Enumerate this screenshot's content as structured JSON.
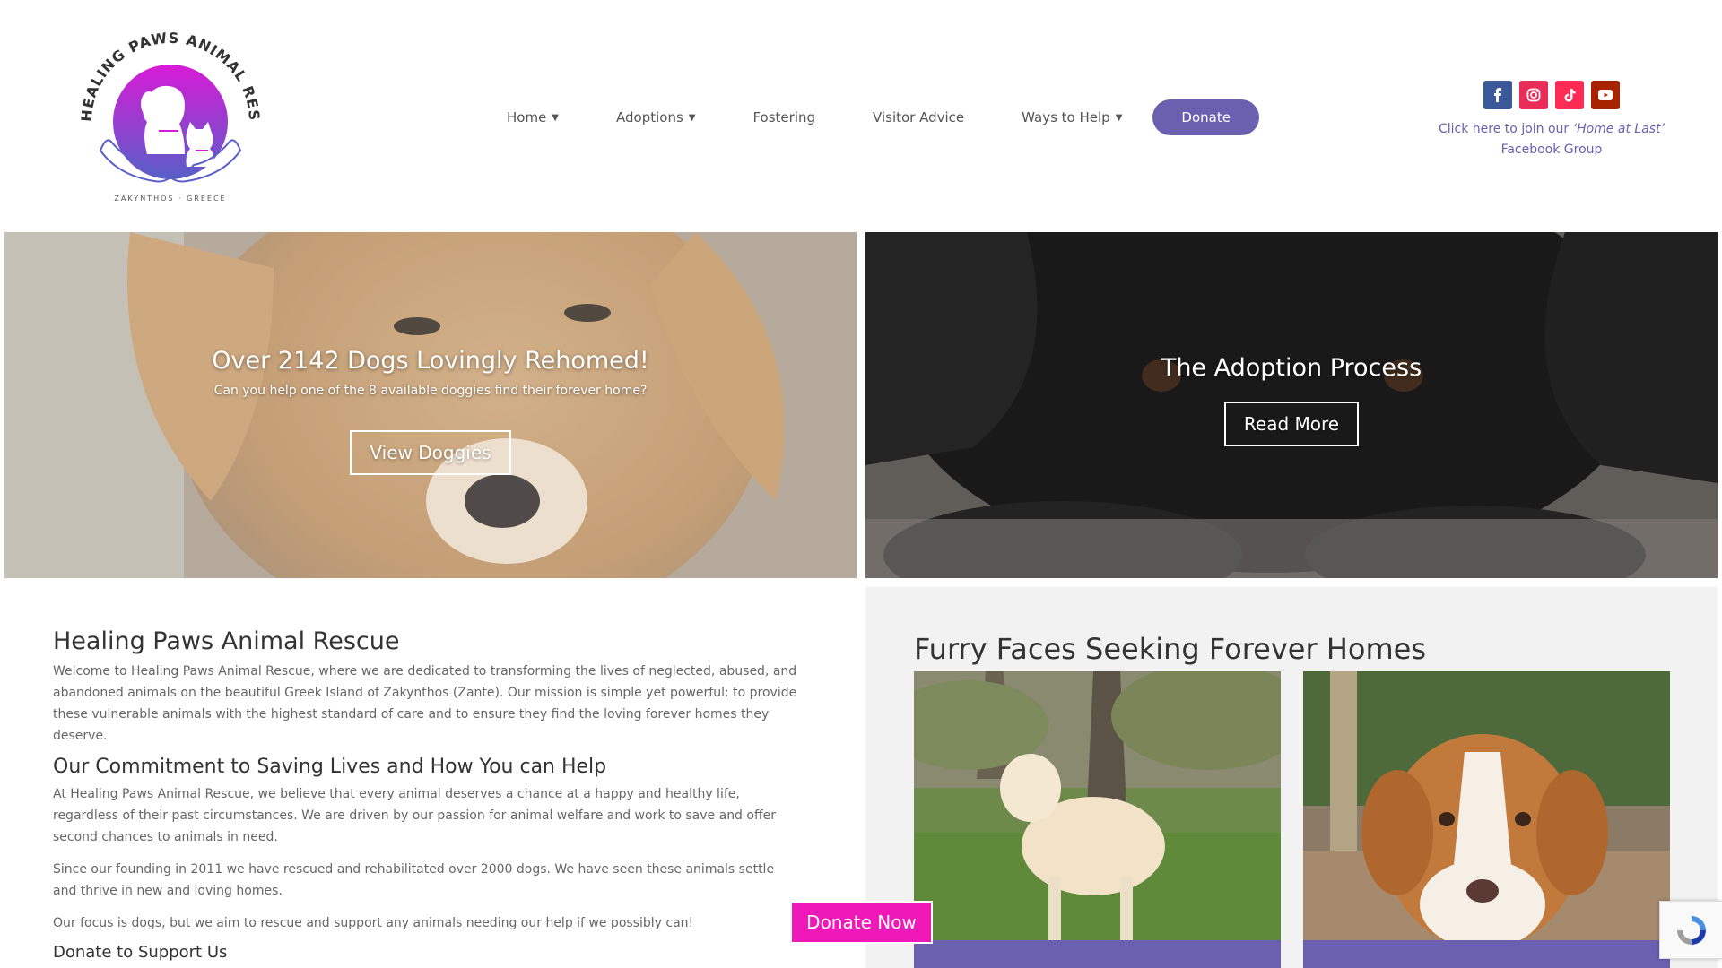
{
  "logo": {
    "arc_text": "HEALING PAWS ANIMAL RESCUE",
    "location": "ZAKYNTHOS · GREECE"
  },
  "nav": {
    "items": [
      {
        "label": "Home",
        "caret": "▼"
      },
      {
        "label": "Adoptions",
        "caret": "▼"
      },
      {
        "label": "Fostering"
      },
      {
        "label": "Visitor Advice"
      },
      {
        "label": "Ways to Help",
        "caret": "▼"
      }
    ],
    "donate_label": "Donate"
  },
  "socials": [
    {
      "icon": "facebook-icon",
      "color": "#3b5998"
    },
    {
      "icon": "instagram-icon",
      "color": "#ea2c59"
    },
    {
      "icon": "tiktok-icon",
      "color": "#fe2c55"
    },
    {
      "icon": "youtube-icon",
      "color": "#a82400"
    }
  ],
  "fb_group": {
    "prefix": "Click here to join our ",
    "name": "‘Home at Last’",
    "suffix": "Facebook Group"
  },
  "hero_left": {
    "title": "Over 2142 Dogs Lovingly Rehomed!",
    "subtitle": "Can you help one of the 8 available doggies find their forever home?",
    "button": "View Doggies"
  },
  "hero_right": {
    "title": "The Adoption Process",
    "button": "Read More"
  },
  "intro": {
    "title": "Healing Paws Animal Rescue",
    "p1": "Welcome to Healing Paws Animal Rescue, where we are dedicated to transforming the lives of neglected, abused, and abandoned animals on the beautiful Greek Island of Zakynthos (Zante). Our mission is simple yet powerful: to provide these vulnerable animals with the highest standard of care and to ensure they find the loving forever homes they deserve.",
    "h_commit": "Our Commitment to Saving Lives and How You can Help",
    "p2": "At Healing Paws Animal Rescue, we believe that every animal deserves a chance at a happy and healthy life, regardless of their past circumstances. We are driven by our passion for animal welfare and work to save and offer second chances to animals in need.",
    "p3": "Since our founding in 2011 we have rescued and rehabilitated over 2000 dogs. We have seen these animals settle and thrive in new and loving homes.",
    "p4": "Our focus is dogs, but we aim to rescue and support any animals needing our help if we possibly can!",
    "h_donate": "Donate to Support Us"
  },
  "furry": {
    "title": "Furry Faces Seeking Forever Homes"
  },
  "floating": {
    "donate_now": "Donate Now"
  },
  "colors": {
    "brand_purple": "#6b5fb0",
    "donate_pink": "#ee19b8",
    "logo_magenta": "#d81ad6"
  }
}
